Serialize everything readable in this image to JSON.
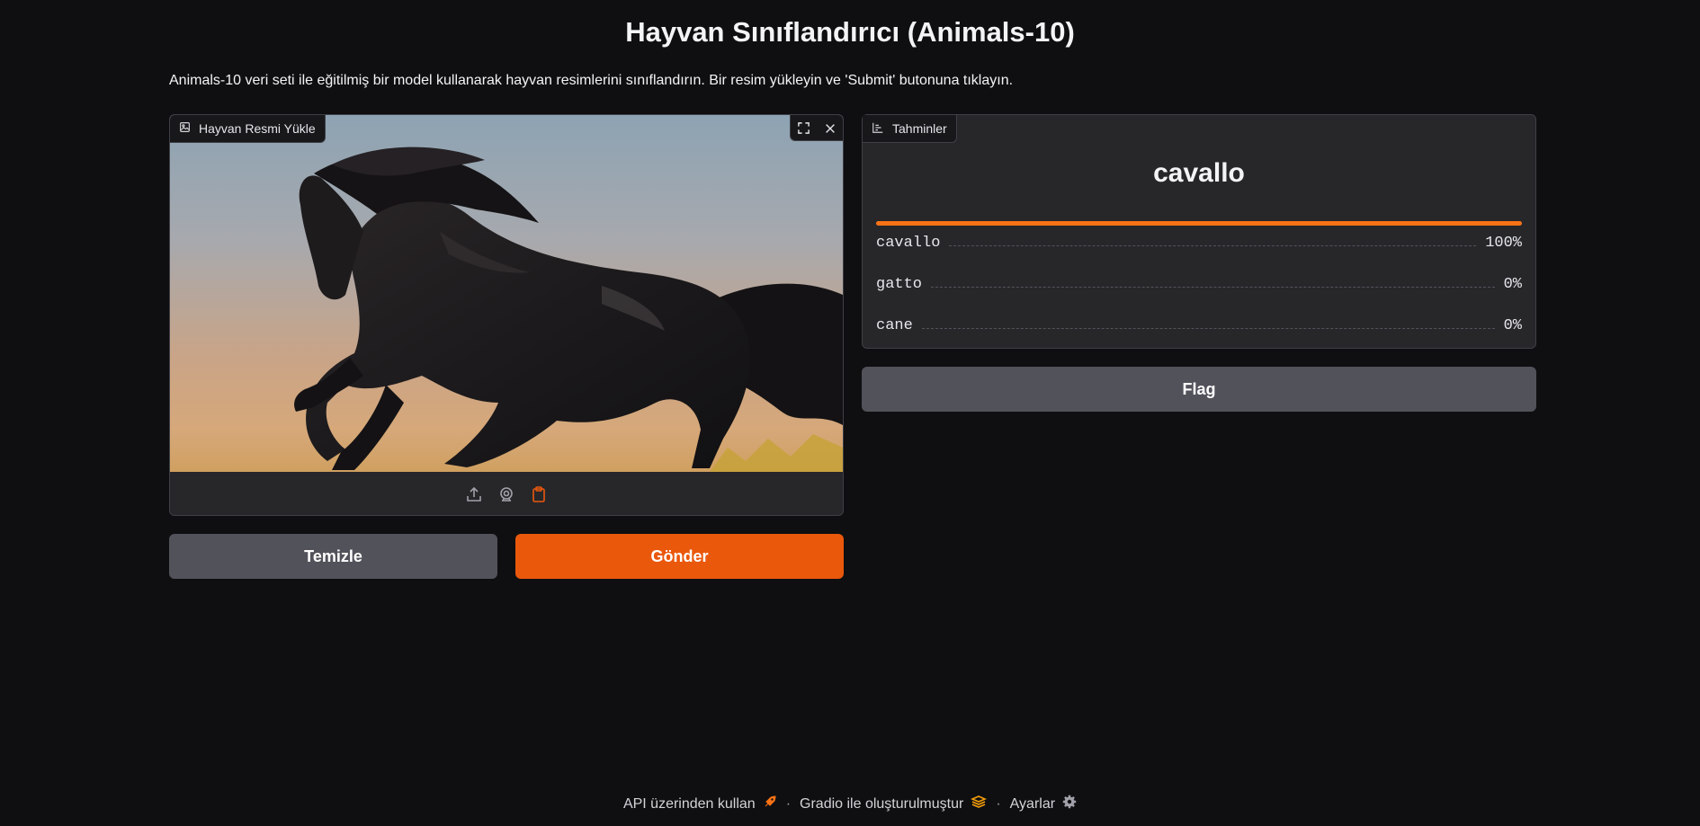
{
  "header": {
    "title": "Hayvan Sınıflandırıcı (Animals-10)",
    "description": "Animals-10 veri seti ile eğitilmiş bir model kullanarak hayvan resimlerini sınıflandırın. Bir resim yükleyin ve 'Submit' butonuna tıklayın."
  },
  "image_input": {
    "label": "Hayvan Resmi Yükle",
    "label_icon": "image-icon",
    "image_subject": "black horse galloping against sunset sky",
    "controls": [
      "fullscreen-icon",
      "close-icon"
    ],
    "sources": [
      "upload-icon",
      "webcam-icon",
      "clipboard-icon"
    ]
  },
  "buttons": {
    "clear": "Temizle",
    "submit": "Gönder",
    "flag": "Flag"
  },
  "predictions": {
    "label": "Tahminler",
    "label_icon": "bar-chart-icon",
    "top_label": "cavallo",
    "top_confidence": 1.0,
    "rows": [
      {
        "label": "cavallo",
        "value": "100%"
      },
      {
        "label": "gatto",
        "value": "0%"
      },
      {
        "label": "cane",
        "value": "0%"
      }
    ]
  },
  "footer": {
    "api": "API üzerinden kullan",
    "built_with": "Gradio ile oluşturulmuştur",
    "settings": "Ayarlar"
  },
  "colors": {
    "background": "#0f0f11",
    "panel": "#27272a",
    "accent": "#ea580c",
    "secondary_button": "#52525b",
    "confidence_bar": "#f97316"
  }
}
